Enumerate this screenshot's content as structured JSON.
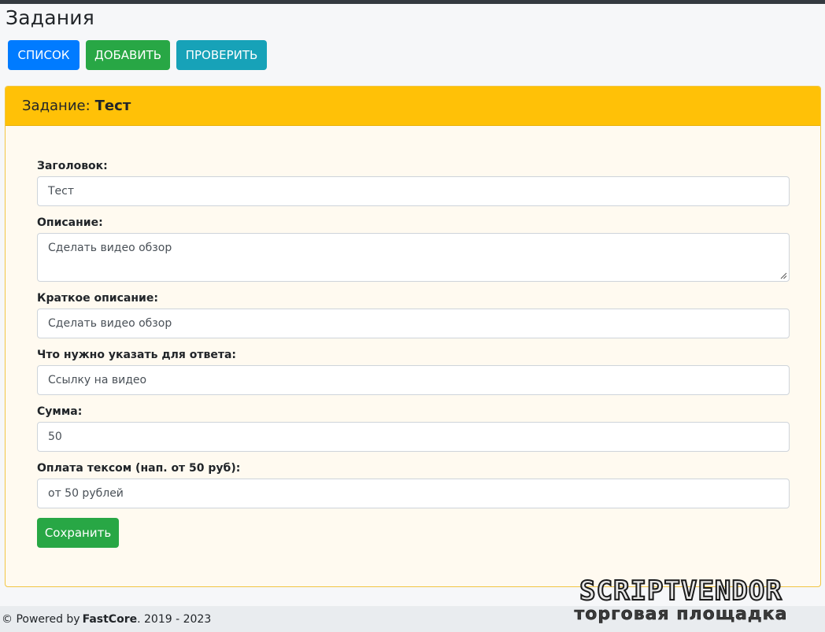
{
  "page": {
    "title": "Задания"
  },
  "nav": {
    "list_label": "СПИСОК",
    "add_label": "ДОБАВИТЬ",
    "check_label": "ПРОВЕРИТЬ"
  },
  "card": {
    "header_prefix": "Задание:",
    "header_name": "Тест"
  },
  "form": {
    "title": {
      "label": "Заголовок:",
      "value": "Тест"
    },
    "description": {
      "label": "Описание:",
      "value": "Сделать видео обзор"
    },
    "short_description": {
      "label": "Краткое описание:",
      "value": "Сделать видео обзор"
    },
    "answer_requirement": {
      "label": "Что нужно указать для ответа:",
      "value": "Ссылку на видео"
    },
    "amount": {
      "label": "Сумма:",
      "value": "50"
    },
    "payment_text": {
      "label": "Оплата тексом (нап. от 50 руб):",
      "value": "от 50 рублей"
    },
    "save_label": "Сохранить"
  },
  "footer": {
    "prefix": "© Powered by",
    "brand": "FastCore",
    "years": ". 2019 - 2023"
  },
  "watermark": {
    "top": "SCRIPTVENDOR",
    "bottom": "торговая площадка"
  },
  "colors": {
    "primary": "#007bff",
    "success": "#28a745",
    "info": "#17a2b8",
    "warning": "#ffc107"
  }
}
